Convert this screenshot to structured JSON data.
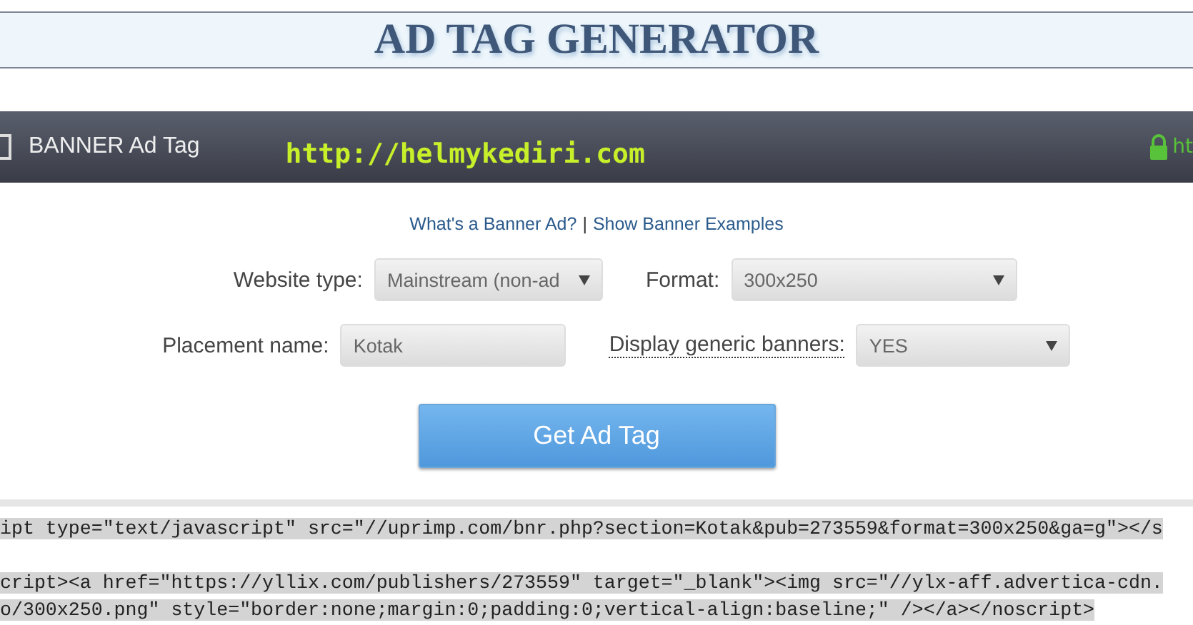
{
  "header": {
    "title": "AD TAG GENERATOR"
  },
  "panel": {
    "title": "BANNER Ad Tag",
    "watermark_url": "http://helmykediri.com",
    "secure_url": "ht"
  },
  "links": [
    {
      "label": "What's a Banner Ad?"
    },
    {
      "label": "Show Banner Examples"
    }
  ],
  "link_separator": "|",
  "form_rows": [
    [
      {
        "label": "Website type:",
        "kind": "select",
        "value": "Mainstream (non-ad",
        "dotted": false
      },
      {
        "label": "Format:",
        "kind": "select",
        "value": "300x250",
        "dotted": false
      }
    ],
    [
      {
        "label": "Placement name:",
        "kind": "input",
        "value": "Kotak",
        "dotted": false
      },
      {
        "label": "Display generic banners:",
        "kind": "select",
        "value": "YES",
        "dotted": true
      }
    ]
  ],
  "button": {
    "label": "Get Ad Tag"
  },
  "code_blocks": [
    {
      "lines": [
        "ipt type=\"text/javascript\" src=\"//uprimp.com/bnr.php?section=Kotak&pub=273559&format=300x250&ga=g\"></s"
      ]
    },
    {
      "lines": [
        "cript><a href=\"https://yllix.com/publishers/273559\" target=\"_blank\"><img src=\"//ylx-aff.advertica-cdn.",
        "o/300x250.png\" style=\"border:none;margin:0;padding:0;vertical-align:baseline;\" /></a></noscript>"
      ]
    }
  ]
}
